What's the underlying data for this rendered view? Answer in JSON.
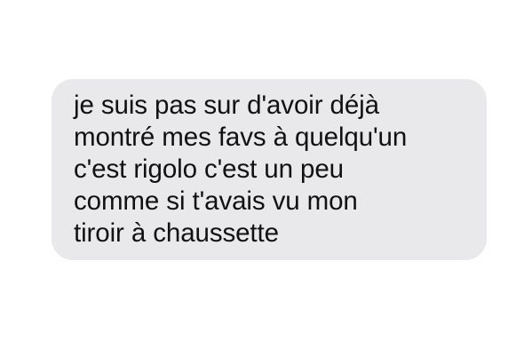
{
  "message": {
    "lines": [
      "je suis pas sur d'avoir déjà",
      "montré mes favs à quelqu'un",
      "c'est rigolo c'est un peu",
      "comme si t'avais vu mon",
      "tiroir à chaussette"
    ]
  },
  "colors": {
    "background": "#ffffff",
    "bubble": "#e9e9eb",
    "text": "#111111"
  }
}
